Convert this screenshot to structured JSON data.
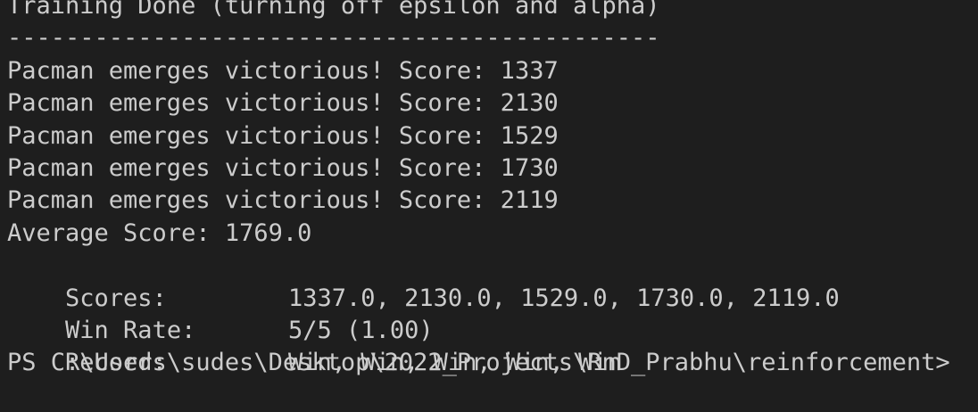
{
  "terminal": {
    "status_line": "Training Done (turning off epsilon and alpha)",
    "separator": "---------------------------------------------",
    "game_results": [
      "Pacman emerges victorious! Score: 1337",
      "Pacman emerges victorious! Score: 2130",
      "Pacman emerges victorious! Score: 1529",
      "Pacman emerges victorious! Score: 1730",
      "Pacman emerges victorious! Score: 2119"
    ],
    "average_score": "Average Score: 1769.0",
    "scores": {
      "label": "Scores:",
      "value": "1337.0, 2130.0, 1529.0, 1730.0, 2119.0"
    },
    "win_rate": {
      "label": "Win Rate:",
      "value": "5/5 (1.00)"
    },
    "record": {
      "label": "Record:",
      "value": "Win, Win, Win, Win, Win"
    },
    "prompt": "PS C:\\Users\\sudes\\Desktop\\2022_Projects\\RnD_Prabhu\\reinforcement>"
  }
}
